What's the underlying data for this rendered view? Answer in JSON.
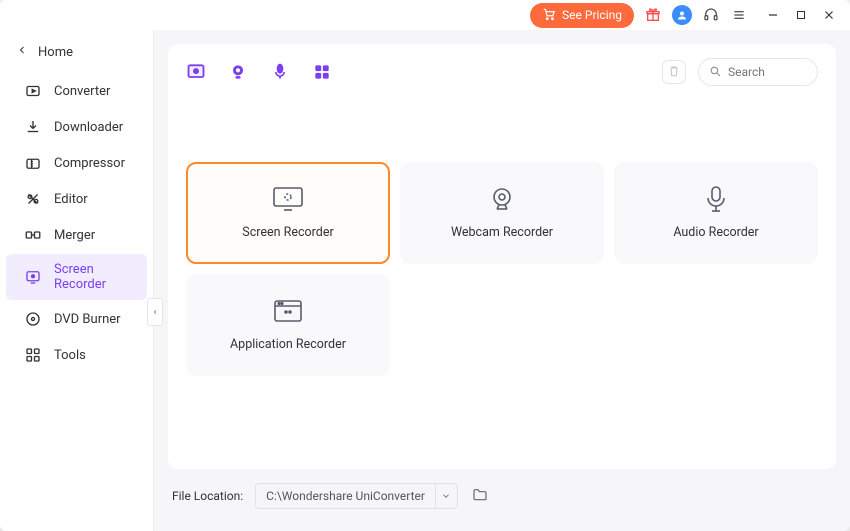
{
  "titlebar": {
    "pricing_label": "See Pricing"
  },
  "sidebar": {
    "home_label": "Home",
    "items": [
      {
        "label": "Converter",
        "icon": "converter-icon"
      },
      {
        "label": "Downloader",
        "icon": "downloader-icon"
      },
      {
        "label": "Compressor",
        "icon": "compressor-icon"
      },
      {
        "label": "Editor",
        "icon": "editor-icon"
      },
      {
        "label": "Merger",
        "icon": "merger-icon"
      },
      {
        "label": "Screen Recorder",
        "icon": "screen-recorder-icon",
        "active": true
      },
      {
        "label": "DVD Burner",
        "icon": "dvd-burner-icon"
      },
      {
        "label": "Tools",
        "icon": "tools-icon"
      }
    ]
  },
  "panel": {
    "search_placeholder": "Search",
    "mode_icons": [
      "screen-mode-icon",
      "webcam-mode-icon",
      "audio-mode-icon",
      "app-mode-icon"
    ]
  },
  "cards": [
    {
      "label": "Screen Recorder",
      "icon": "screen-recorder-icon",
      "selected": true
    },
    {
      "label": "Webcam Recorder",
      "icon": "webcam-recorder-icon"
    },
    {
      "label": "Audio Recorder",
      "icon": "audio-recorder-icon"
    },
    {
      "label": "Application Recorder",
      "icon": "application-recorder-icon"
    }
  ],
  "footer": {
    "label": "File Location:",
    "path": "C:\\Wondershare UniConverter"
  },
  "colors": {
    "accent_purple": "#7b3ff2",
    "accent_orange": "#ff8a2a"
  }
}
